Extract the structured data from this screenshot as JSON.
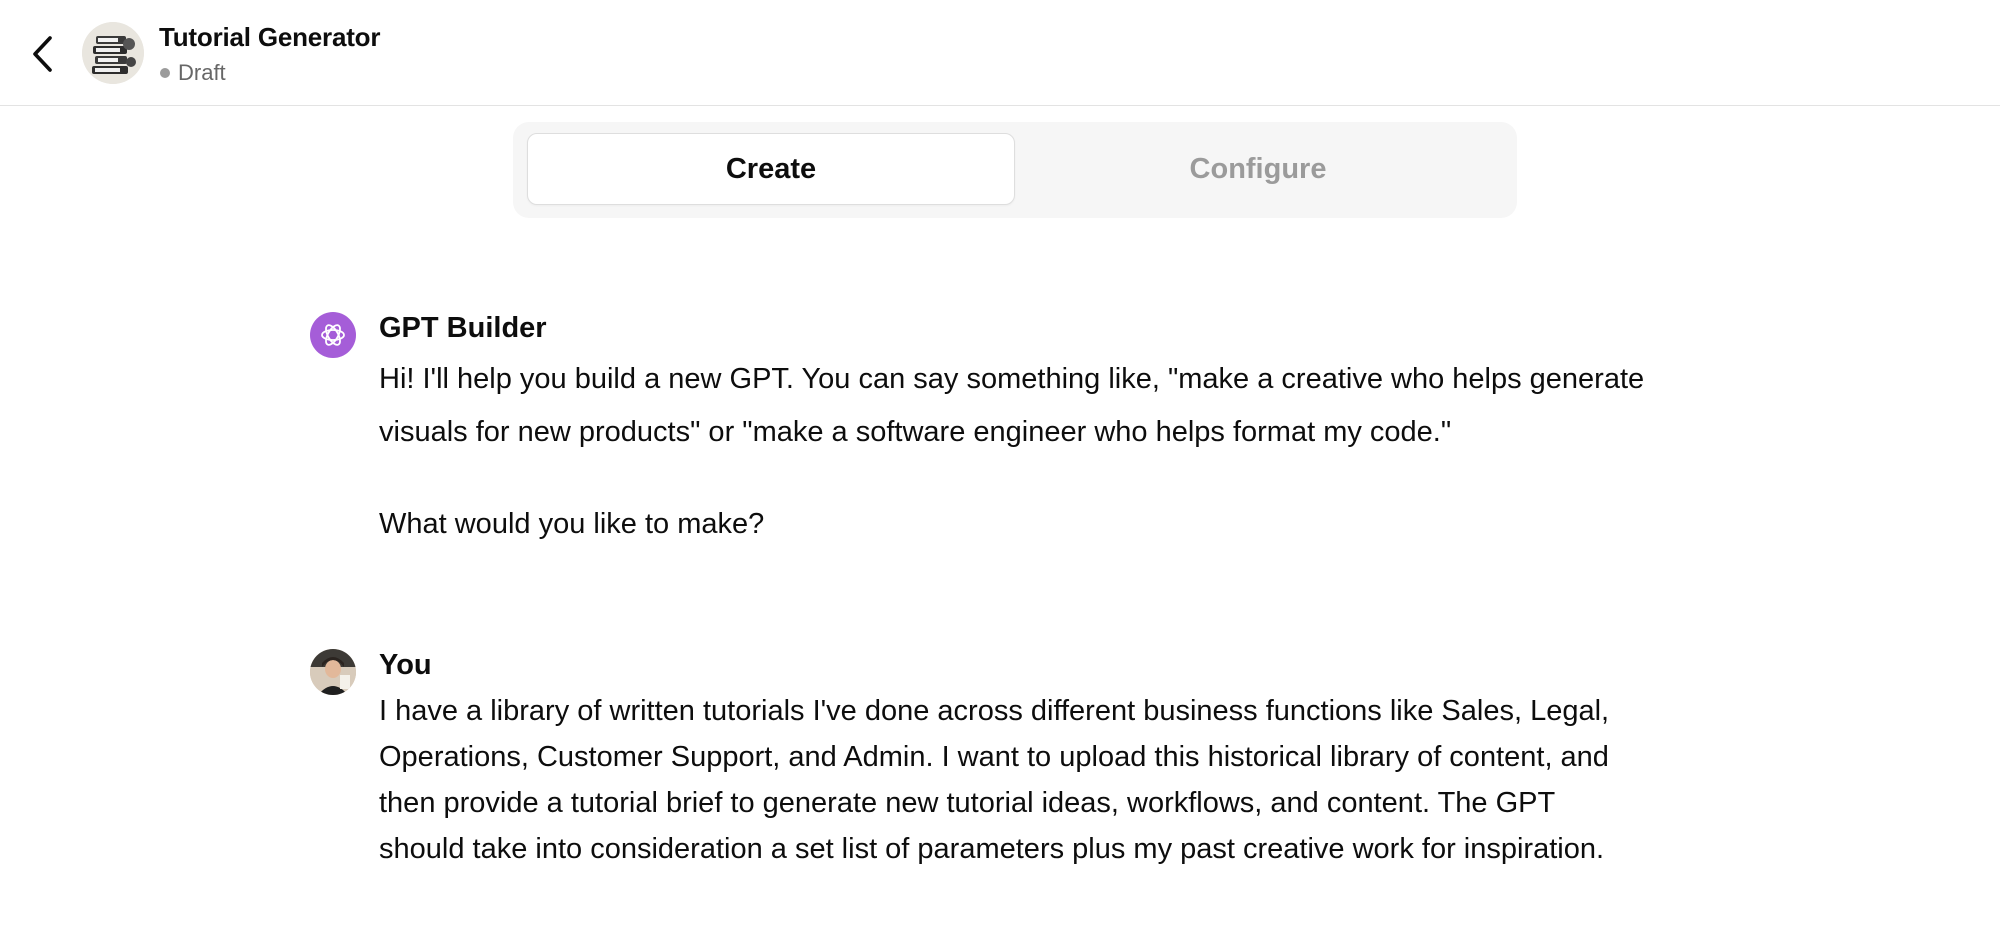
{
  "header": {
    "back_icon": "chevron-left-icon",
    "gpt_name": "Tutorial Generator",
    "status": "Draft"
  },
  "tabs": [
    {
      "label": "Create",
      "active": true
    },
    {
      "label": "Configure",
      "active": false
    }
  ],
  "messages": [
    {
      "author": "GPT Builder",
      "avatar_icon": "openai-logo-icon",
      "avatar_color": "#a55dd8",
      "lines": [
        "Hi! I'll help you build a new GPT. You can say something like, \"make a creative who helps generate",
        "visuals for new products\" or \"make a software engineer who helps format my code.\"",
        "What would you like to make?"
      ]
    },
    {
      "author": "You",
      "avatar_icon": "user-photo-avatar",
      "lines": [
        "I have a library of written tutorials I've done across different business functions like Sales, Legal,",
        "Operations, Customer Support, and Admin. I want to upload this historical library of content, and",
        "then provide a tutorial brief to generate new tutorial ideas, workflows, and content. The GPT",
        "should take into consideration a set list of parameters plus my past creative work for inspiration."
      ]
    }
  ],
  "colors": {
    "accent_builder": "#a55dd8",
    "tab_inactive": "#9b9b9b",
    "tab_bar_bg": "#f6f6f6",
    "status_dot": "#9b9b9b"
  }
}
